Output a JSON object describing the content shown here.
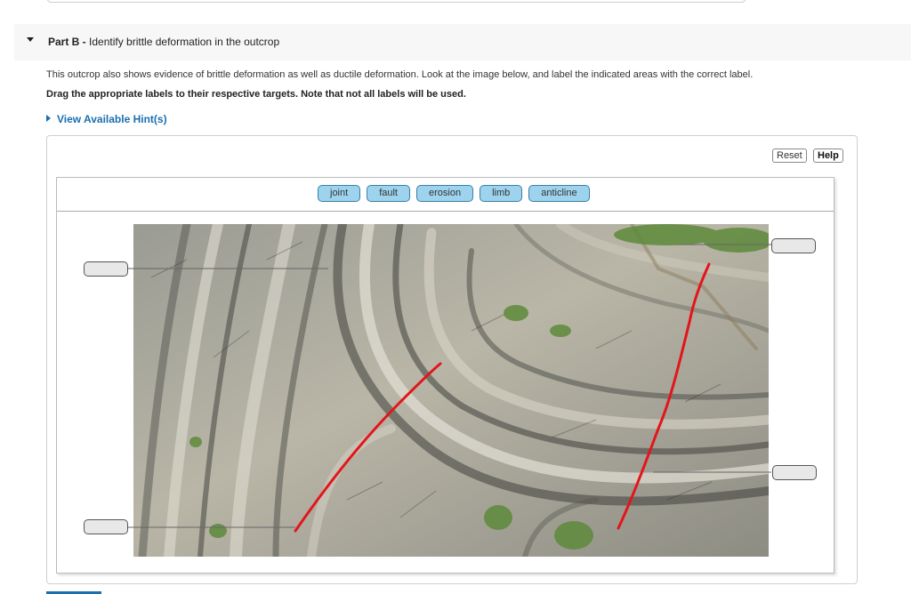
{
  "part": {
    "label": "Part B -",
    "title": "Identify brittle deformation in the outcrop"
  },
  "intro": "This outcrop also shows evidence of brittle deformation as well as ductile deformation. Look at the image below, and label the indicated areas with the correct label.",
  "instruction": "Drag the appropriate labels to their respective targets. Note that not all labels will be used.",
  "hint": {
    "label": "View Available Hint(s)"
  },
  "toolbar": {
    "reset_label": "Reset",
    "help_label": "Help"
  },
  "labels": [
    "joint",
    "fault",
    "erosion",
    "limb",
    "anticline"
  ],
  "targets": [
    "",
    "",
    "",
    ""
  ],
  "colors": {
    "chip_fill": "#9ed3ee",
    "chip_border": "#3b7fa5",
    "fault_line": "#e3151b",
    "link": "#1a6fb0",
    "target_fill": "#e8e8e8"
  }
}
